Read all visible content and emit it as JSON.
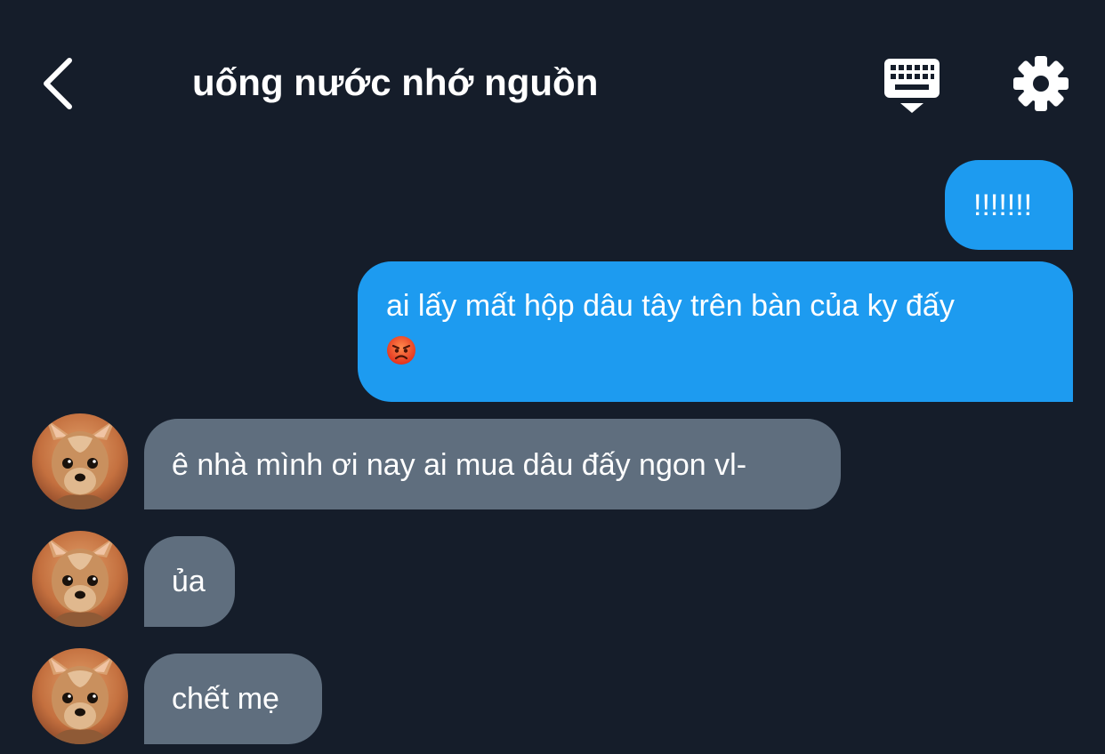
{
  "header": {
    "title": "uống nước nhớ nguồn",
    "back_icon": "chevron-left-icon",
    "keyboard_icon": "keyboard-icon",
    "settings_icon": "gear-icon"
  },
  "colors": {
    "background": "#151d2a",
    "outgoing_bubble": "#1d9bf0",
    "incoming_bubble": "#5f6e7e",
    "text": "#ffffff"
  },
  "messages": [
    {
      "direction": "outgoing",
      "text": "!!!!!!!"
    },
    {
      "direction": "outgoing",
      "text": "ai lấy mất hộp dâu tây trên bàn của ky đấy",
      "emoji": "angry-face-icon"
    },
    {
      "direction": "incoming",
      "text": "ê nhà mình ơi nay ai mua dâu đấy ngon vl-",
      "avatar": "dog-avatar"
    },
    {
      "direction": "incoming",
      "text": "ủa",
      "avatar": "dog-avatar"
    },
    {
      "direction": "incoming",
      "text": "chết mẹ",
      "avatar": "dog-avatar"
    }
  ]
}
